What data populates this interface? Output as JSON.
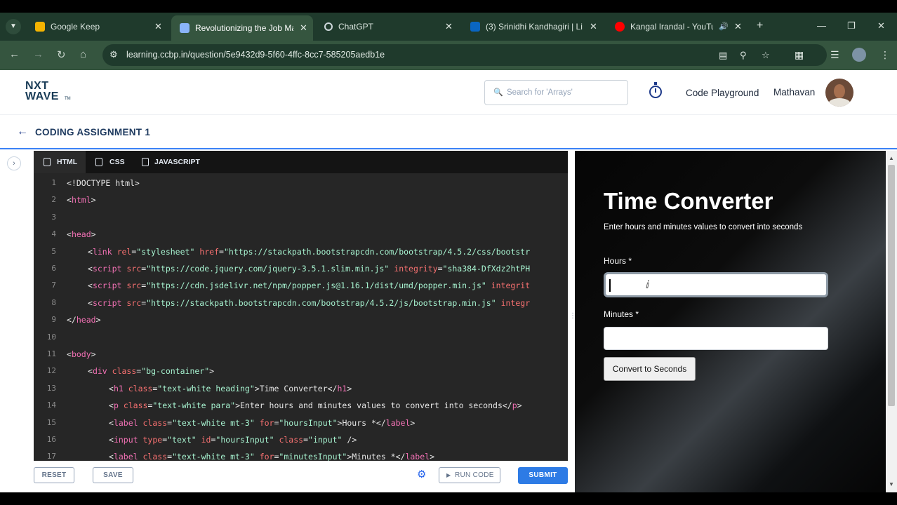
{
  "browser": {
    "tabs": [
      {
        "title": "Google Keep",
        "favicon_color": "#f5b400"
      },
      {
        "title": "Revolutionizing the Job Mar",
        "favicon_color": "#8ab4f8"
      },
      {
        "title": "ChatGPT",
        "favicon_color": "#cfd8dc"
      },
      {
        "title": "(3) Srinidhi Kandhagiri | Lin",
        "favicon_color": "#0a66c2"
      },
      {
        "title": "Kangal Irandal - YouTub",
        "favicon_color": "#ff0000"
      }
    ],
    "url": "learning.ccbp.in/question/5e9432d9-5f60-4ffc-8cc7-585205aedb1e"
  },
  "header": {
    "logo_line1": "NXT",
    "logo_line2": "WAVE",
    "logo_tm": "TM",
    "search_placeholder": "Search for 'Arrays'",
    "playground_label": "Code Playground",
    "user_name": "Mathavan"
  },
  "subheader": {
    "title": "CODING ASSIGNMENT 1"
  },
  "editor": {
    "tabs": [
      "HTML",
      "CSS",
      "JAVASCRIPT"
    ],
    "lines": [
      {
        "n": "1",
        "indent": 0,
        "parts": [
          [
            "t",
            "<!DOCTYPE html>"
          ]
        ]
      },
      {
        "n": "2",
        "indent": 0,
        "parts": [
          [
            "t",
            "<"
          ],
          [
            "g",
            "html"
          ],
          [
            "t",
            ">"
          ]
        ]
      },
      {
        "n": "3",
        "indent": 0,
        "parts": []
      },
      {
        "n": "4",
        "indent": 0,
        "parts": [
          [
            "t",
            "<"
          ],
          [
            "g",
            "head"
          ],
          [
            "t",
            ">"
          ]
        ]
      },
      {
        "n": "5",
        "indent": 1,
        "parts": [
          [
            "t",
            "<"
          ],
          [
            "g",
            "link"
          ],
          [
            "t",
            " "
          ],
          [
            "a",
            "rel"
          ],
          [
            "t",
            "="
          ],
          [
            "s",
            "\"stylesheet\""
          ],
          [
            "t",
            " "
          ],
          [
            "a",
            "href"
          ],
          [
            "t",
            "="
          ],
          [
            "s",
            "\"https://stackpath.bootstrapcdn.com/bootstrap/4.5.2/css/bootstr"
          ]
        ]
      },
      {
        "n": "6",
        "indent": 1,
        "parts": [
          [
            "t",
            "<"
          ],
          [
            "g",
            "script"
          ],
          [
            "t",
            " "
          ],
          [
            "a",
            "src"
          ],
          [
            "t",
            "="
          ],
          [
            "s",
            "\"https://code.jquery.com/jquery-3.5.1.slim.min.js\""
          ],
          [
            "t",
            " "
          ],
          [
            "a",
            "integrity"
          ],
          [
            "t",
            "="
          ],
          [
            "s",
            "\"sha384-DfXdz2htPH"
          ]
        ]
      },
      {
        "n": "7",
        "indent": 1,
        "parts": [
          [
            "t",
            "<"
          ],
          [
            "g",
            "script"
          ],
          [
            "t",
            " "
          ],
          [
            "a",
            "src"
          ],
          [
            "t",
            "="
          ],
          [
            "s",
            "\"https://cdn.jsdelivr.net/npm/popper.js@1.16.1/dist/umd/popper.min.js\""
          ],
          [
            "t",
            " "
          ],
          [
            "a",
            "integrit"
          ]
        ]
      },
      {
        "n": "8",
        "indent": 1,
        "parts": [
          [
            "t",
            "<"
          ],
          [
            "g",
            "script"
          ],
          [
            "t",
            " "
          ],
          [
            "a",
            "src"
          ],
          [
            "t",
            "="
          ],
          [
            "s",
            "\"https://stackpath.bootstrapcdn.com/bootstrap/4.5.2/js/bootstrap.min.js\""
          ],
          [
            "t",
            " "
          ],
          [
            "a",
            "integr"
          ]
        ]
      },
      {
        "n": "9",
        "indent": 0,
        "parts": [
          [
            "t",
            "</"
          ],
          [
            "g",
            "head"
          ],
          [
            "t",
            ">"
          ]
        ]
      },
      {
        "n": "10",
        "indent": 0,
        "parts": []
      },
      {
        "n": "11",
        "indent": 0,
        "parts": [
          [
            "t",
            "<"
          ],
          [
            "g",
            "body"
          ],
          [
            "t",
            ">"
          ]
        ]
      },
      {
        "n": "12",
        "indent": 1,
        "parts": [
          [
            "t",
            "<"
          ],
          [
            "g",
            "div"
          ],
          [
            "t",
            " "
          ],
          [
            "a",
            "class"
          ],
          [
            "t",
            "="
          ],
          [
            "s",
            "\"bg-container\""
          ],
          [
            "t",
            ">"
          ]
        ]
      },
      {
        "n": "13",
        "indent": 2,
        "parts": [
          [
            "t",
            "<"
          ],
          [
            "g",
            "h1"
          ],
          [
            "t",
            " "
          ],
          [
            "a",
            "class"
          ],
          [
            "t",
            "="
          ],
          [
            "s",
            "\"text-white heading\""
          ],
          [
            "t",
            ">Time Converter</"
          ],
          [
            "g",
            "h1"
          ],
          [
            "t",
            ">"
          ]
        ]
      },
      {
        "n": "14",
        "indent": 2,
        "parts": [
          [
            "t",
            "<"
          ],
          [
            "g",
            "p"
          ],
          [
            "t",
            " "
          ],
          [
            "a",
            "class"
          ],
          [
            "t",
            "="
          ],
          [
            "s",
            "\"text-white para\""
          ],
          [
            "t",
            ">Enter hours and minutes values to convert into seconds</"
          ],
          [
            "g",
            "p"
          ],
          [
            "t",
            ">"
          ]
        ]
      },
      {
        "n": "15",
        "indent": 2,
        "parts": [
          [
            "t",
            "<"
          ],
          [
            "g",
            "label"
          ],
          [
            "t",
            " "
          ],
          [
            "a",
            "class"
          ],
          [
            "t",
            "="
          ],
          [
            "s",
            "\"text-white mt-3\""
          ],
          [
            "t",
            " "
          ],
          [
            "a",
            "for"
          ],
          [
            "t",
            "="
          ],
          [
            "s",
            "\"hoursInput\""
          ],
          [
            "t",
            ">Hours *</"
          ],
          [
            "g",
            "label"
          ],
          [
            "t",
            ">"
          ]
        ]
      },
      {
        "n": "16",
        "indent": 2,
        "parts": [
          [
            "t",
            "<"
          ],
          [
            "g",
            "input"
          ],
          [
            "t",
            " "
          ],
          [
            "a",
            "type"
          ],
          [
            "t",
            "="
          ],
          [
            "s",
            "\"text\""
          ],
          [
            "t",
            " "
          ],
          [
            "a",
            "id"
          ],
          [
            "t",
            "="
          ],
          [
            "s",
            "\"hoursInput\""
          ],
          [
            "t",
            " "
          ],
          [
            "a",
            "class"
          ],
          [
            "t",
            "="
          ],
          [
            "s",
            "\"input\""
          ],
          [
            "t",
            " />"
          ]
        ]
      },
      {
        "n": "17",
        "indent": 2,
        "parts": [
          [
            "t",
            "<"
          ],
          [
            "g",
            "label"
          ],
          [
            "t",
            " "
          ],
          [
            "a",
            "class"
          ],
          [
            "t",
            "="
          ],
          [
            "s",
            "\"text-white mt-3\""
          ],
          [
            "t",
            " "
          ],
          [
            "a",
            "for"
          ],
          [
            "t",
            "="
          ],
          [
            "s",
            "\"minutesInput\""
          ],
          [
            "t",
            ">Minutes *</"
          ],
          [
            "g",
            "label"
          ],
          [
            "t",
            ">"
          ]
        ]
      }
    ]
  },
  "preview": {
    "heading": "Time Converter",
    "description": "Enter hours and minutes values to convert into seconds",
    "hours_label": "Hours *",
    "hours_value": "",
    "minutes_label": "Minutes *",
    "minutes_value": "",
    "convert_button": "Convert to Seconds"
  },
  "actions": {
    "reset": "RESET",
    "save": "SAVE",
    "run_code": "RUN CODE",
    "submit": "SUBMIT"
  }
}
